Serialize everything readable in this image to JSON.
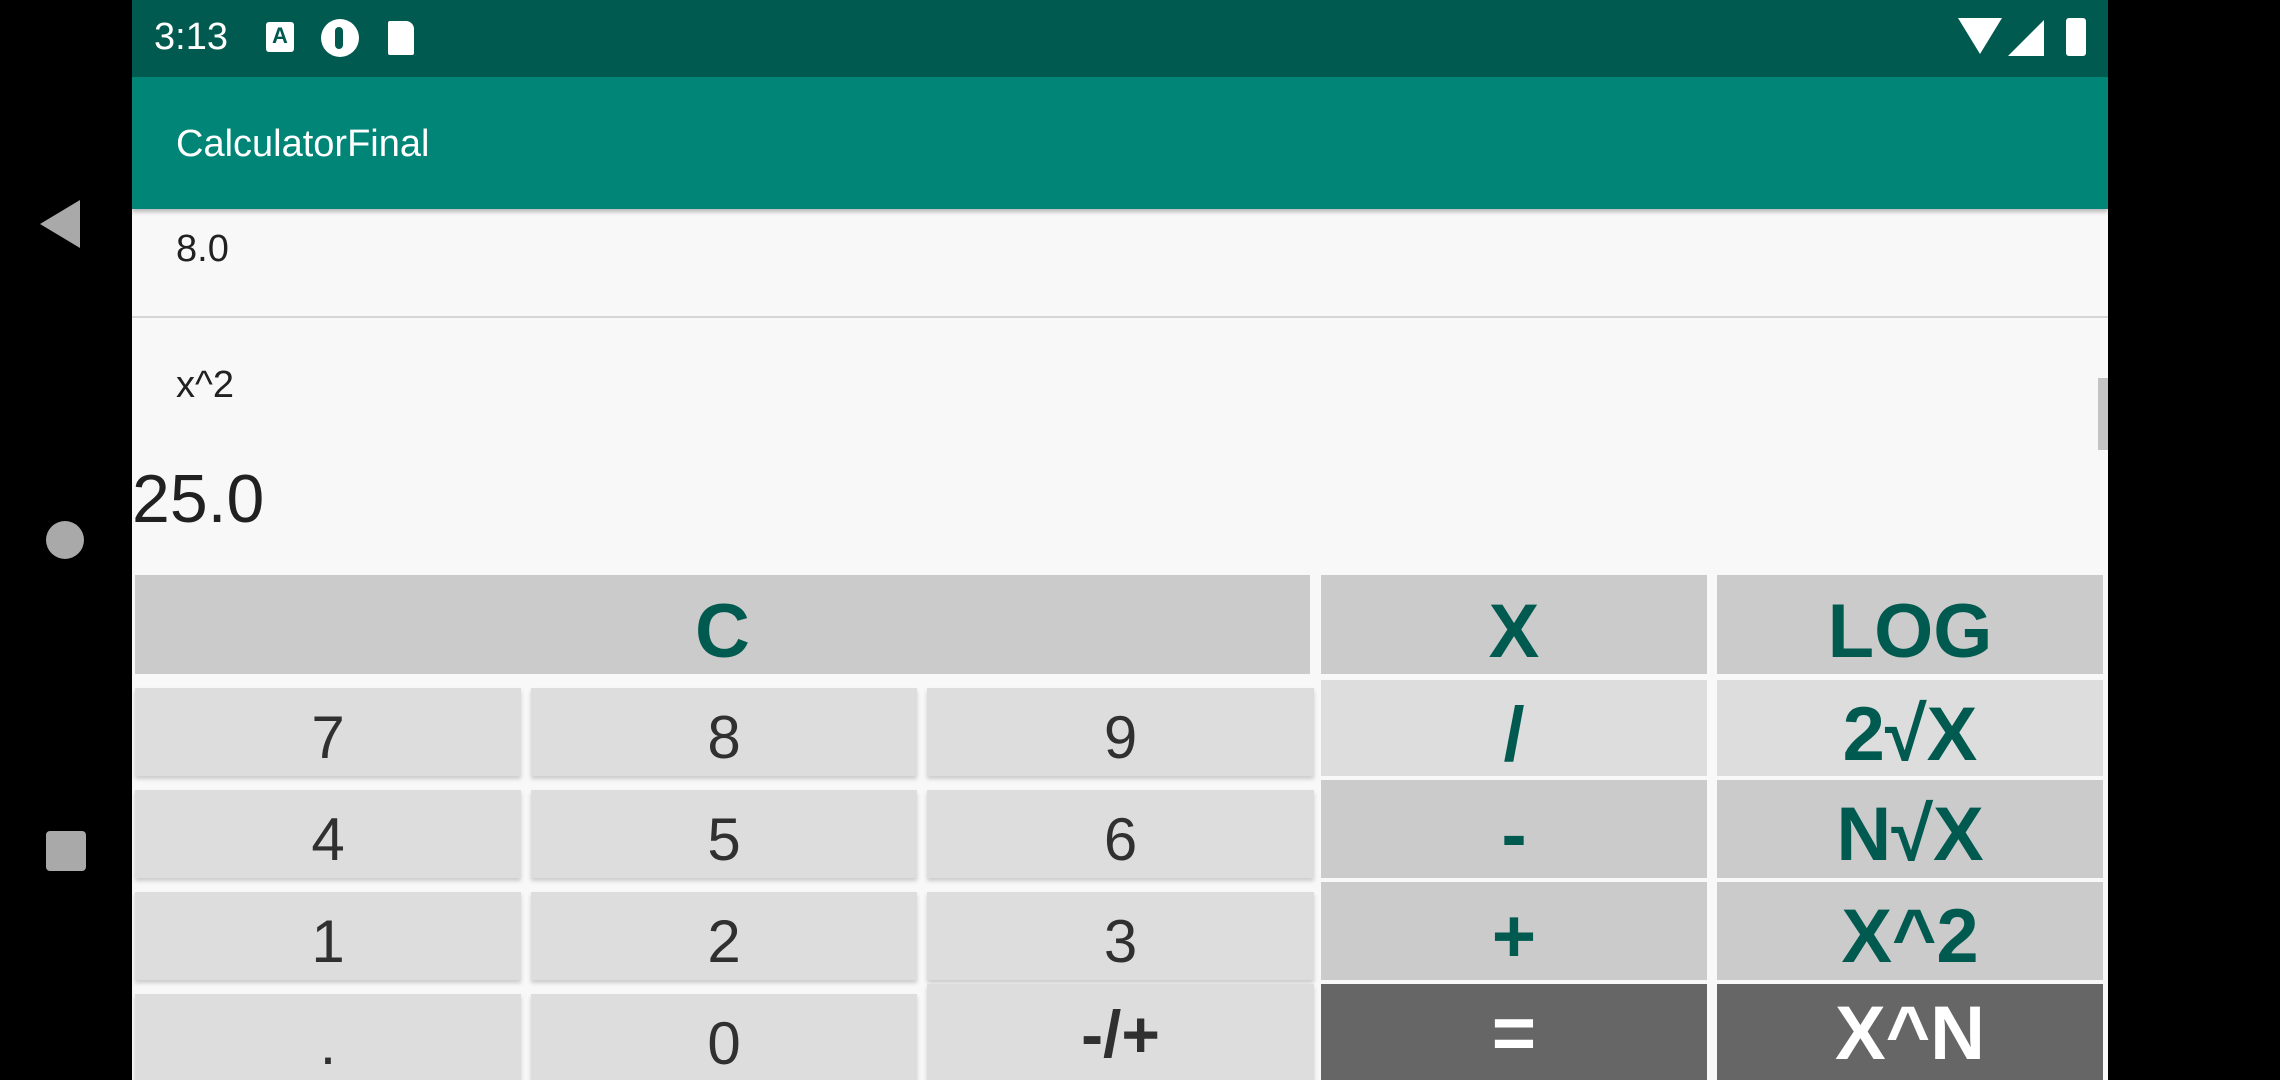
{
  "status_bar": {
    "time": "3:13",
    "notification_icons": [
      "keyboard-a-icon",
      "circle-app-icon",
      "sd-card-icon"
    ],
    "system_icons": [
      "wifi-icon",
      "signal-icon",
      "battery-icon"
    ],
    "notification_a_glyph": "A"
  },
  "app_bar": {
    "title": "CalculatorFinal"
  },
  "history": [
    {
      "text": "8.0"
    },
    {
      "text": "x^2"
    }
  ],
  "display": {
    "result": "25.0"
  },
  "keys": {
    "clear": "C",
    "multiply": "X",
    "log": "LOG",
    "seven": "7",
    "eight": "8",
    "nine": "9",
    "divide": "/",
    "sqrt2": "2√X",
    "four": "4",
    "five": "5",
    "six": "6",
    "minus": "-",
    "nroot": "N√X",
    "one": "1",
    "two": "2",
    "three": "3",
    "plus": "+",
    "square": "X^2",
    "dot": ".",
    "zero": "0",
    "negate": "-/+",
    "equals": "=",
    "power": "X^N"
  },
  "colors": {
    "status_bar": "#005a4f",
    "app_bar": "#008577",
    "operator_text": "#005a4f",
    "number_key_bg": "#dddddd",
    "operator_key_bg": "#cbcbcb",
    "dark_key_bg": "#666666"
  }
}
